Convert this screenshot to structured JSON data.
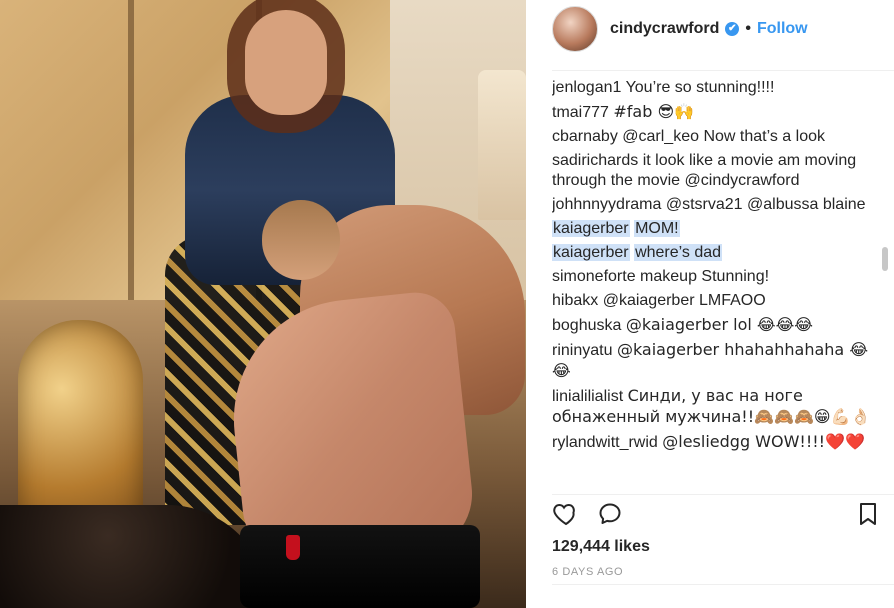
{
  "post": {
    "header": {
      "username": "cindycrawford",
      "verified_symbol": "✔",
      "dot": "•",
      "follow_label": "Follow"
    },
    "comments": [
      {
        "user": "jenlogan1",
        "text": "You’re so stunning!!!!",
        "highlight": false
      },
      {
        "user": "tmai777",
        "text": "#fab 😎🙌",
        "highlight": false
      },
      {
        "user": "cbarnaby",
        "text": "@carl_keo Now that’s a look",
        "highlight": false
      },
      {
        "user": "sadirichards",
        "text": "it look like a movie am moving through the movie @cindycrawford",
        "highlight": false
      },
      {
        "user": "johhnnyydrama",
        "text": "@stsrva21 @albussa blaine",
        "highlight": false
      },
      {
        "user": "kaiagerber",
        "text": "MOM!",
        "highlight": true
      },
      {
        "user": "kaiagerber",
        "text": "where’s dad",
        "highlight": true
      },
      {
        "user": "simoneforte makeup",
        "text": "Stunning!",
        "highlight": false
      },
      {
        "user": "hibakx",
        "text": "@kaiagerber LMFAOO",
        "highlight": false
      },
      {
        "user": "boghuska",
        "text": "@kaiagerber lol 😂😂😂",
        "highlight": false
      },
      {
        "user": "rininyatu",
        "text": "@kaiagerber hhahahhahaha 😂😂",
        "highlight": false
      },
      {
        "user": "linialilialist",
        "text": "Синди, у вас на ноге обнаженный мужчина!!🙈🙈🙈😁💪🏻👌🏻",
        "highlight": false
      },
      {
        "user": "rylandwitt_rwid",
        "text": "@lesliedgg WOW!!!!❤️❤️",
        "highlight": false
      }
    ],
    "likes_text": "129,444 likes",
    "time_text": "6 DAYS AGO"
  },
  "icons": {
    "heart": "heart-icon",
    "comment": "comment-icon",
    "bookmark": "bookmark-icon"
  },
  "colors": {
    "link_blue": "#3897f0",
    "highlight_blue": "#cfe1f7",
    "text": "#262626",
    "muted": "#999999"
  }
}
